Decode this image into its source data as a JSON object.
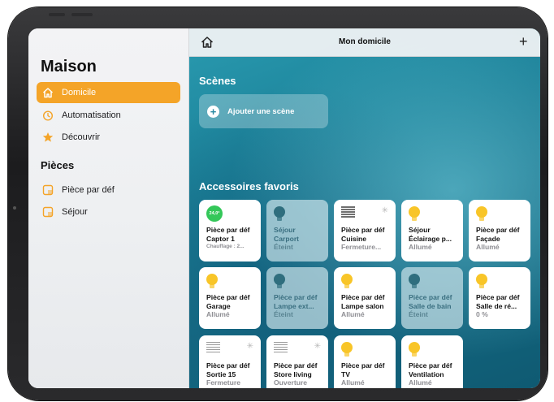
{
  "sidebar": {
    "title": "Maison",
    "items": [
      {
        "label": "Domicile",
        "icon": "home-icon",
        "active": true
      },
      {
        "label": "Automatisation",
        "icon": "clock-icon",
        "active": false
      },
      {
        "label": "Découvrir",
        "icon": "star-icon",
        "active": false
      }
    ],
    "rooms_title": "Pièces",
    "rooms": [
      {
        "label": "Pièce par déf",
        "icon": "room-icon"
      },
      {
        "label": "Séjour",
        "icon": "room-icon"
      }
    ]
  },
  "topbar": {
    "title": "Mon domicile",
    "home_icon": "home-icon",
    "add_label": "+"
  },
  "scenes": {
    "title": "Scènes",
    "add_label": "Ajouter une scène"
  },
  "favorites": {
    "title": "Accessoires favoris",
    "tiles": [
      {
        "icon": "thermostat-icon",
        "badge": "24,0°",
        "l1": "Pièce par déf",
        "l2": "Captor 1",
        "l3": "Chauffage : 2...",
        "state": "on"
      },
      {
        "icon": "bulb-icon",
        "l1": "Séjour",
        "l2": "Carport",
        "l3": "Éteint",
        "state": "off"
      },
      {
        "icon": "shutter-icon",
        "l1": "Pièce par déf",
        "l2": "Cuisine",
        "l3": "Fermeture...",
        "state": "on"
      },
      {
        "icon": "bulb-icon",
        "l1": "Séjour",
        "l2": "Éclairage p...",
        "l3": "Allumé",
        "state": "on"
      },
      {
        "icon": "bulb-icon",
        "l1": "Pièce par déf",
        "l2": "Façade",
        "l3": "Allumé",
        "state": "on"
      },
      {
        "icon": "bulb-icon",
        "l1": "Pièce par déf",
        "l2": "Garage",
        "l3": "Allumé",
        "state": "on"
      },
      {
        "icon": "bulb-icon",
        "l1": "Pièce par déf",
        "l2": "Lampe ext...",
        "l3": "Éteint",
        "state": "off"
      },
      {
        "icon": "bulb-icon",
        "l1": "Pièce par déf",
        "l2": "Lampe salon",
        "l3": "Allumé",
        "state": "on"
      },
      {
        "icon": "bulb-icon",
        "l1": "Pièce par déf",
        "l2": "Salle de bain",
        "l3": "Éteint",
        "state": "off"
      },
      {
        "icon": "bulb-icon",
        "l1": "Pièce par déf",
        "l2": "Salle de ré...",
        "l3": "0 %",
        "state": "on"
      },
      {
        "icon": "shutter-icon",
        "l1": "Pièce par déf",
        "l2": "Sortie 15",
        "l3": "Fermeture",
        "state": "on"
      },
      {
        "icon": "shutter-icon",
        "l1": "Pièce par déf",
        "l2": "Store living",
        "l3": "Ouverture",
        "state": "on"
      },
      {
        "icon": "bulb-icon",
        "l1": "Pièce par déf",
        "l2": "TV",
        "l3": "Allumé",
        "state": "on"
      },
      {
        "icon": "bulb-icon",
        "l1": "Pièce par déf",
        "l2": "Ventilation",
        "l3": "Allumé",
        "state": "on"
      }
    ]
  },
  "colors": {
    "accent": "#f4a428",
    "bulb_on": "#f8c528",
    "thermostat": "#34c759"
  }
}
